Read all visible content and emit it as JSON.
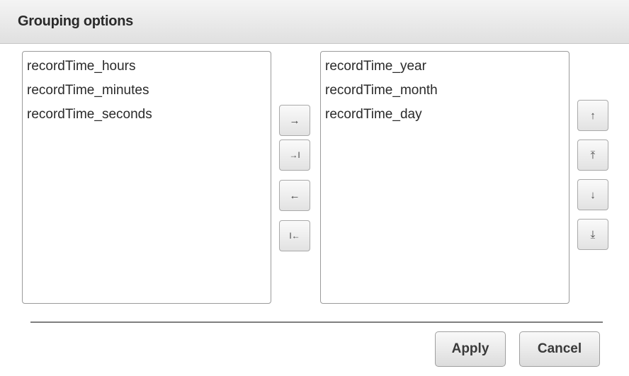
{
  "dialog": {
    "title": "Grouping options"
  },
  "available_list": {
    "items": [
      "recordTime_hours",
      "recordTime_minutes",
      "recordTime_seconds"
    ]
  },
  "selected_list": {
    "items": [
      "recordTime_year",
      "recordTime_month",
      "recordTime_day"
    ]
  },
  "transfer_buttons": {
    "move_right": "→",
    "move_all_right": "→I",
    "move_left": "←",
    "move_all_left": "I←"
  },
  "order_buttons": {
    "move_up": "↑",
    "move_top": "⤒",
    "move_down": "↓",
    "move_bottom": "⤓"
  },
  "footer": {
    "apply_label": "Apply",
    "cancel_label": "Cancel"
  }
}
